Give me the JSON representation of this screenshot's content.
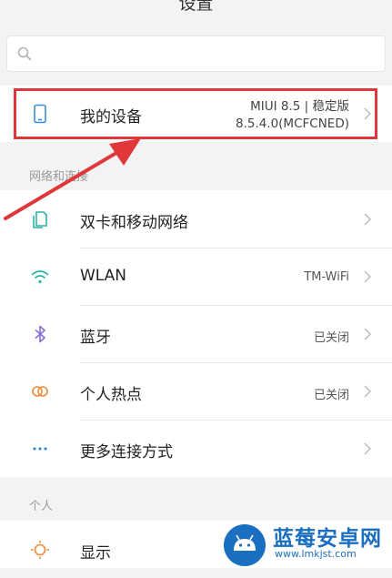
{
  "header": {
    "title": "设置"
  },
  "search": {
    "placeholder": ""
  },
  "device": {
    "label": "我的设备",
    "value_line1": "MIUI 8.5 | 稳定版",
    "value_line2": "8.5.4.0(MCFCNED)"
  },
  "sections": {
    "network": {
      "title": "网络和连接",
      "items": [
        {
          "label": "双卡和移动网络",
          "value": ""
        },
        {
          "label": "WLAN",
          "value": "TM-WiFi"
        },
        {
          "label": "蓝牙",
          "value": "已关闭"
        },
        {
          "label": "个人热点",
          "value": "已关闭"
        },
        {
          "label": "更多连接方式",
          "value": ""
        }
      ]
    },
    "personal": {
      "title": "个人",
      "items": [
        {
          "label": "显示",
          "value": ""
        }
      ]
    }
  },
  "watermark": {
    "title": "蓝莓安卓网",
    "url": "www.lmkjst.com"
  },
  "colors": {
    "annotation_red": "#e0383a",
    "icon_teal": "#2bb3a6",
    "icon_purple": "#8a6dd6",
    "icon_orange": "#f08a3c",
    "icon_blue": "#3a8fd9"
  }
}
